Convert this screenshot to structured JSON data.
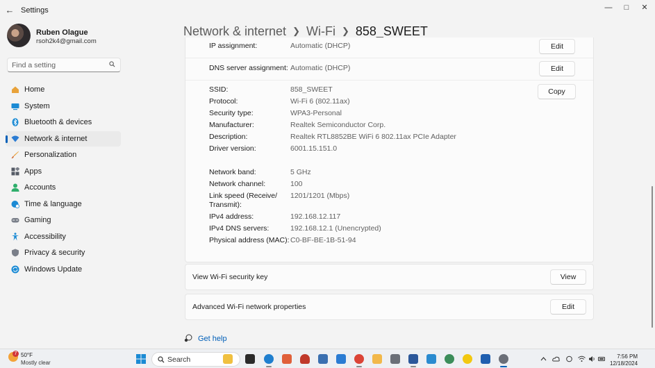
{
  "window": {
    "title": "Settings",
    "back_icon": "back-arrow-icon",
    "controls": [
      "minimize-icon",
      "maximize-icon",
      "close-icon"
    ]
  },
  "user": {
    "name": "Ruben Olague",
    "email": "rsoh2k4@gmail.com"
  },
  "search": {
    "placeholder": "Find a setting"
  },
  "sidebar": {
    "items": [
      {
        "label": "Home",
        "icon": "home-icon",
        "color": "#e8a23a"
      },
      {
        "label": "System",
        "icon": "system-icon",
        "color": "#1a8ad4"
      },
      {
        "label": "Bluetooth & devices",
        "icon": "bluetooth-icon",
        "color": "#1a8ad4"
      },
      {
        "label": "Network & internet",
        "icon": "wifi-icon",
        "color": "#2b7cd3",
        "active": true
      },
      {
        "label": "Personalization",
        "icon": "brush-icon",
        "color": "#e8a23a"
      },
      {
        "label": "Apps",
        "icon": "apps-icon",
        "color": "#555b66"
      },
      {
        "label": "Accounts",
        "icon": "person-icon",
        "color": "#2fae6b"
      },
      {
        "label": "Time & language",
        "icon": "globe-clock-icon",
        "color": "#1a8ad4"
      },
      {
        "label": "Gaming",
        "icon": "gamepad-icon",
        "color": "#7a7f89"
      },
      {
        "label": "Accessibility",
        "icon": "accessibility-icon",
        "color": "#1a8ad4"
      },
      {
        "label": "Privacy & security",
        "icon": "shield-icon",
        "color": "#7a7f89"
      },
      {
        "label": "Windows Update",
        "icon": "update-icon",
        "color": "#1a8ad4"
      }
    ]
  },
  "breadcrumb": {
    "parts": [
      "Network & internet",
      "Wi-Fi"
    ],
    "current": "858_SWEET"
  },
  "ip_assignment": {
    "label": "IP assignment:",
    "value": "Automatic (DHCP)",
    "button": "Edit"
  },
  "dns_assignment": {
    "label": "DNS server assignment:",
    "value": "Automatic (DHCP)",
    "button": "Edit"
  },
  "properties": {
    "copy_button": "Copy",
    "group1": [
      {
        "label": "SSID:",
        "value": "858_SWEET"
      },
      {
        "label": "Protocol:",
        "value": "Wi-Fi 6 (802.11ax)"
      },
      {
        "label": "Security type:",
        "value": "WPA3-Personal"
      },
      {
        "label": "Manufacturer:",
        "value": "Realtek Semiconductor Corp."
      },
      {
        "label": "Description:",
        "value": "Realtek RTL8852BE WiFi 6 802.11ax PCIe Adapter"
      },
      {
        "label": "Driver version:",
        "value": "6001.15.151.0"
      }
    ],
    "group2": [
      {
        "label": "Network band:",
        "value": "5 GHz"
      },
      {
        "label": "Network channel:",
        "value": "100"
      },
      {
        "label": "Link speed (Receive/",
        "label2": "Transmit):",
        "value": "1201/1201 (Mbps)"
      },
      {
        "label": "IPv4 address:",
        "value": "192.168.12.117"
      },
      {
        "label": "IPv4 DNS servers:",
        "value": "192.168.12.1 (Unencrypted)"
      },
      {
        "label": "Physical address (MAC):",
        "value": "C0-BF-BE-1B-51-94"
      }
    ]
  },
  "security_key": {
    "label": "View Wi-Fi security key",
    "button": "View"
  },
  "advanced": {
    "label": "Advanced Wi-Fi network properties",
    "button": "Edit"
  },
  "help": {
    "label": "Get help",
    "icon": "help-icon"
  },
  "taskbar": {
    "weather": {
      "temp": "50°F",
      "desc": "Mostly clear",
      "badge": "7"
    },
    "search_label": "Search",
    "apps": [
      {
        "icon": "file-explorer-panel-icon",
        "color": "#f0c040"
      },
      {
        "icon": "terminal-icon",
        "color": "#2b2b2b"
      },
      {
        "icon": "edge-icon",
        "color": "#1f7fcf"
      },
      {
        "icon": "paint-icon",
        "color": "#e0603a"
      },
      {
        "icon": "headset-icon",
        "color": "#c0392b"
      },
      {
        "icon": "photos-icon",
        "color": "#3a6fb0"
      },
      {
        "icon": "snipping-icon",
        "color": "#2b7cd3"
      },
      {
        "icon": "chrome-icon",
        "color": "#db4437"
      },
      {
        "icon": "folder-icon",
        "color": "#f2b84b"
      },
      {
        "icon": "calculator-icon",
        "color": "#6b6f78"
      },
      {
        "icon": "word-icon",
        "color": "#2b579a"
      },
      {
        "icon": "notepad-icon",
        "color": "#2a8bd0"
      },
      {
        "icon": "network-app-icon",
        "color": "#3c8d5a"
      },
      {
        "icon": "norton-icon",
        "color": "#f2c811"
      },
      {
        "icon": "feedback-icon",
        "color": "#1f5fb0"
      },
      {
        "icon": "settings-gear-icon",
        "color": "#6b6f78"
      }
    ],
    "tray": [
      "chevron-up-icon",
      "onedrive-icon",
      "sync-icon",
      "wifi-tray-icon",
      "volume-icon",
      "battery-icon"
    ],
    "time": "7:56 PM",
    "date": "12/18/2024"
  },
  "colors": {
    "accent": "#005fb8",
    "background": "#f3f3f3",
    "card": "#fbfbfb"
  }
}
